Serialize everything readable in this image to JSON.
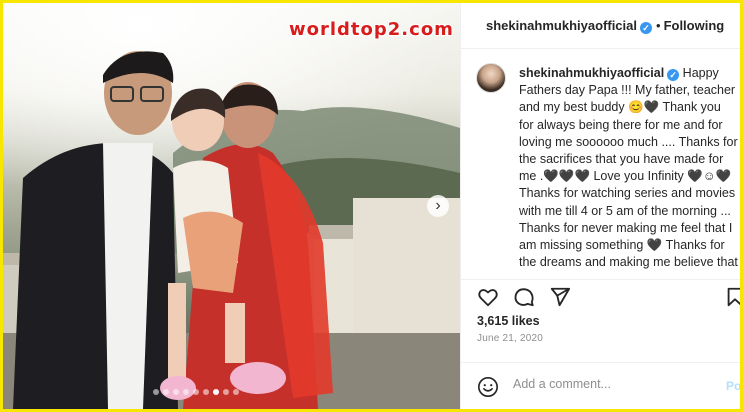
{
  "watermark": "worldtop2.com",
  "post": {
    "username": "shekinahmukhiya",
    "username_suffix": "official",
    "header_username": "shekinahmukhiyaofficial",
    "following_label": "Following",
    "caption_user": "shekinahmukhiyaofficial",
    "caption_text": "Happy Fathers day Papa !!! My father, teacher and my best buddy 😊🖤 Thank you for always being there for me and for loving me soooooo much .... Thanks for the sacrifices that you have made for me .🖤🖤🖤 Love you Infinity 🖤☺🖤 Thanks for watching series and movies with me till 4 or 5 am of the morning ... Thanks for never making me feel that I am missing something 🖤 Thanks for the dreams and making me believe that I can fulfill them all",
    "likes": "3,615 likes",
    "date": "June 21, 2020",
    "comment_placeholder": "Add a comment...",
    "post_label": "Post",
    "carousel_total": 9,
    "carousel_active": 7
  },
  "icons": {
    "verified": "verified-badge-icon",
    "like": "heart-icon",
    "comment": "comment-icon",
    "share": "share-icon",
    "save": "bookmark-icon",
    "emoji": "smiley-icon",
    "next": "chevron-right-icon"
  },
  "colors": {
    "accent": "#3897f0",
    "watermark": "#d81c1c",
    "border_frame": "#f7e600"
  }
}
